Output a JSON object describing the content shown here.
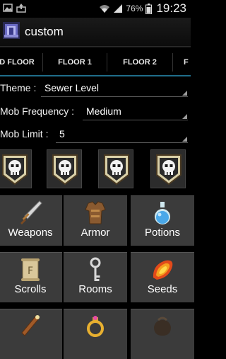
{
  "status_bar": {
    "battery": "76%",
    "time": "19:23",
    "icons": [
      "photo-icon",
      "upload-icon",
      "wifi-icon",
      "signal-icon",
      "battery-icon"
    ]
  },
  "action_bar": {
    "title": "custom",
    "icon": "dungeon-icon"
  },
  "tabs": [
    {
      "label": "D FLOOR"
    },
    {
      "label": "FLOOR 1"
    },
    {
      "label": "FLOOR 2"
    },
    {
      "label": "F"
    }
  ],
  "settings": {
    "theme": {
      "label": "Theme :",
      "value": "Sewer Level"
    },
    "mob_frequency": {
      "label": "Mob Frequency :",
      "value": "Medium"
    },
    "mob_limit": {
      "label": "Mob Limit :",
      "value": "5"
    }
  },
  "skull_buttons": [
    {
      "icon": "skull-shield-icon"
    },
    {
      "icon": "skull-shield-icon"
    },
    {
      "icon": "skull-shield-icon"
    },
    {
      "icon": "skull-shield-icon"
    }
  ],
  "categories": [
    {
      "label": "Weapons",
      "icon": "sword-icon"
    },
    {
      "label": "Armor",
      "icon": "armor-icon"
    },
    {
      "label": "Potions",
      "icon": "potion-icon"
    },
    {
      "label": "Scrolls",
      "icon": "scroll-icon"
    },
    {
      "label": "Rooms",
      "icon": "key-icon"
    },
    {
      "label": "Seeds",
      "icon": "seed-icon"
    },
    {
      "label": "",
      "icon": "wand-icon"
    },
    {
      "label": "",
      "icon": "ring-icon"
    },
    {
      "label": "",
      "icon": "bag-icon"
    }
  ],
  "colors": {
    "tab_accent": "#33b5e5",
    "tile_bg": "#3b3b3b",
    "background": "#000000"
  }
}
